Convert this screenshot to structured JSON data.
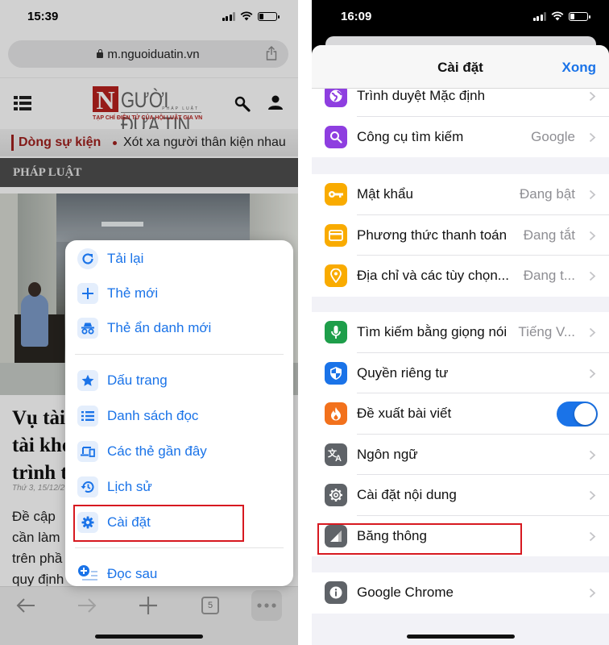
{
  "left": {
    "status": {
      "time": "15:39"
    },
    "url": "m.nguoiduatin.vn",
    "site": {
      "logo_letter": "N",
      "logo_name": "GƯỜI ĐƯA TIN",
      "logo_sub": "PHÁP LUẬT",
      "logo_tagline": "TẠP CHÍ ĐIỆN TỬ CỦA HỘI LUẬT GIA VN"
    },
    "ticker": {
      "label": "Dòng sự kiện",
      "headline": "Xót xa người thân kiện nhau"
    },
    "section": "PHÁP LUẬT",
    "article": {
      "title": "Vụ tài\ntài kho\ntrình t",
      "date": "Thứ 3, 15/12/2",
      "body": "Đề cập\ncần làm\ntrên phầ\nquy định"
    },
    "menu": {
      "items": [
        {
          "label": "Tải lại",
          "icon": "reload-icon"
        },
        {
          "label": "Thẻ mới",
          "icon": "plus-icon"
        },
        {
          "label": "Thẻ ẩn danh mới",
          "icon": "incognito-icon"
        },
        {
          "label": "Dấu trang",
          "icon": "star-icon"
        },
        {
          "label": "Danh sách đọc",
          "icon": "reading-list-icon"
        },
        {
          "label": "Các thẻ gần đây",
          "icon": "recent-tabs-icon"
        },
        {
          "label": "Lịch sử",
          "icon": "history-icon"
        },
        {
          "label": "Cài đặt",
          "icon": "gear-icon"
        },
        {
          "label": "Đọc sau",
          "icon": "read-later-icon"
        }
      ]
    },
    "toolbar": {
      "tab_count": "5"
    }
  },
  "right": {
    "status": {
      "time": "16:09"
    },
    "nav": {
      "title": "Cài đặt",
      "done": "Xong"
    },
    "groups": [
      [
        {
          "label": "Trình duyệt Mặc định",
          "value": "",
          "icon": "globe-icon",
          "color": "#8e3ee0"
        },
        {
          "label": "Công cụ tìm kiếm",
          "value": "Google",
          "icon": "search-icon",
          "color": "#8e3ee0"
        }
      ],
      [
        {
          "label": "Mật khẩu",
          "value": "Đang bật",
          "icon": "key-icon",
          "color": "#f9ab00"
        },
        {
          "label": "Phương thức thanh toán",
          "value": "Đang tắt",
          "icon": "credit-card-icon",
          "color": "#f9ab00"
        },
        {
          "label": "Địa chỉ và các tùy chọn...",
          "value": "Đang t...",
          "icon": "location-pin-icon",
          "color": "#f9ab00"
        }
      ],
      [
        {
          "label": "Tìm kiếm bằng giọng nói",
          "value": "Tiếng V...",
          "icon": "microphone-icon",
          "color": "#1e9e4a"
        },
        {
          "label": "Quyền riêng tư",
          "value": "",
          "icon": "shield-icon",
          "color": "#1a73e8"
        },
        {
          "label": "Đề xuất bài viết",
          "value": "",
          "icon": "flame-icon",
          "color": "#f2711c",
          "toggle": true
        },
        {
          "label": "Ngôn ngữ",
          "value": "",
          "icon": "translate-icon",
          "color": "#5f6368"
        },
        {
          "label": "Cài đặt nội dung",
          "value": "",
          "icon": "gear-icon",
          "color": "#5f6368"
        },
        {
          "label": "Băng thông",
          "value": "",
          "icon": "bandwidth-icon",
          "color": "#5f6368"
        }
      ],
      [
        {
          "label": "Google Chrome",
          "value": "",
          "icon": "info-icon",
          "color": "#5f6368"
        }
      ]
    ]
  },
  "colors": {
    "accent": "#1a73e8",
    "highlight": "#d71920",
    "brand_red": "#b8201e"
  }
}
